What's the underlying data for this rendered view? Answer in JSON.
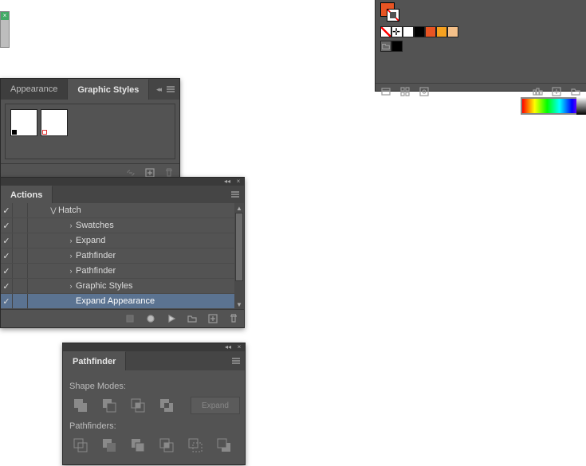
{
  "graphic_styles_panel": {
    "tabs": [
      {
        "label": "Appearance",
        "active": false
      },
      {
        "label": "Graphic Styles",
        "active": true
      }
    ]
  },
  "actions_panel": {
    "tab_label": "Actions",
    "items": [
      {
        "indent": 1,
        "twisty": "v",
        "label": "Hatch",
        "checked": true,
        "selected": false
      },
      {
        "indent": 2,
        "twisty": ">",
        "label": "Swatches",
        "checked": true,
        "selected": false
      },
      {
        "indent": 2,
        "twisty": ">",
        "label": "Expand",
        "checked": true,
        "selected": false
      },
      {
        "indent": 2,
        "twisty": ">",
        "label": "Pathfinder",
        "checked": true,
        "selected": false
      },
      {
        "indent": 2,
        "twisty": ">",
        "label": "Pathfinder",
        "checked": true,
        "selected": false
      },
      {
        "indent": 2,
        "twisty": ">",
        "label": "Graphic Styles",
        "checked": true,
        "selected": false
      },
      {
        "indent": 2,
        "twisty": "",
        "label": "Expand Appearance",
        "checked": true,
        "selected": true
      }
    ]
  },
  "pathfinder_panel": {
    "tab_label": "Pathfinder",
    "shape_modes_label": "Shape Modes:",
    "pathfinders_label": "Pathfinders:",
    "expand_label": "Expand"
  },
  "swatches_panel": {
    "fill_color": "#e85423",
    "row1": [
      "none",
      "registration",
      "#ffffff",
      "#000000",
      "#e85423",
      "#f6a11f",
      "#f4c089"
    ],
    "row2": [
      "folder",
      "#000000"
    ]
  }
}
